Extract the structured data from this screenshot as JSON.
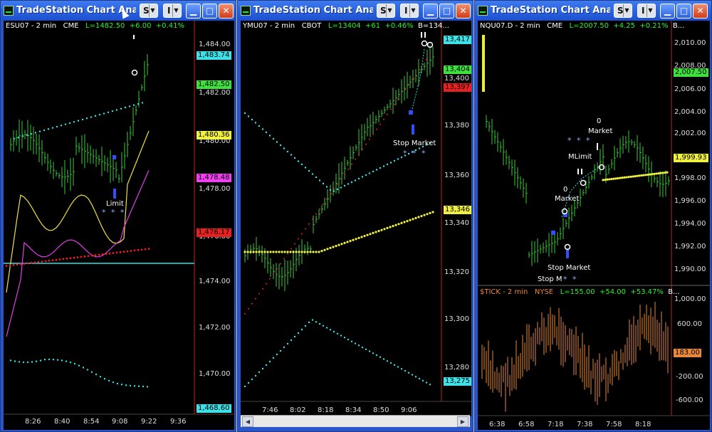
{
  "windows": [
    {
      "title": "TradeStation Chart Anal...",
      "info": {
        "symbol": "ESU07 - 2 min",
        "exchange": "CME",
        "last": "L=1482.50",
        "change": "+6.00",
        "pct": "+0.41%",
        "extra": ""
      },
      "price_labels": [
        "1,484.00",
        "1,482.00",
        "1,480.00",
        "1,478.00",
        "1,476.00",
        "1,474.00",
        "1,472.00",
        "1,470.00"
      ],
      "price_boxes": [
        {
          "text": "1,483.74",
          "color": "#40e0e8"
        },
        {
          "text": "1,482.50",
          "color": "#3ee03e"
        },
        {
          "text": "1,480.36",
          "color": "#f0f040"
        },
        {
          "text": "1,478.48",
          "color": "#f040f0"
        },
        {
          "text": "1,476.17",
          "color": "#e82020"
        },
        {
          "text": "1,468.60",
          "color": "#40e0e8"
        }
      ],
      "time_labels": [
        "8:26",
        "8:40",
        "8:54",
        "9:08",
        "9:22",
        "9:36"
      ],
      "annotations": [
        {
          "text": "Limit"
        }
      ],
      "stars": [
        "* * *"
      ],
      "button_s": "S",
      "button_i": "I"
    },
    {
      "title": "TradeStation Chart Anal...",
      "info": {
        "symbol": "YMU07 - 2 min",
        "exchange": "CBOT",
        "last": "L=13404",
        "change": "+61",
        "pct": "+0.46%",
        "extra": "B=134..."
      },
      "price_labels": [
        "13,400",
        "13,380",
        "13,360",
        "13,340",
        "13,320",
        "13,300",
        "13,280"
      ],
      "price_boxes": [
        {
          "text": "13,417",
          "color": "#40e0e8"
        },
        {
          "text": "13,404",
          "color": "#3ee03e"
        },
        {
          "text": "13,397",
          "color": "#e82020"
        },
        {
          "text": "13,346",
          "color": "#f0f040"
        },
        {
          "text": "13,275",
          "color": "#40e0e8"
        }
      ],
      "time_labels": [
        "7:46",
        "8:02",
        "8:18",
        "8:34",
        "8:50",
        "9:06"
      ],
      "annotations": [
        {
          "text": "Stop Market"
        }
      ],
      "stars": [
        "* * *"
      ],
      "button_s": "S",
      "button_i": "I"
    },
    {
      "title": "TradeStation Chart Anal...",
      "info": {
        "symbol": "NQU07.D - 2 min",
        "exchange": "CME",
        "last": "L=2007.50",
        "change": "+4.25",
        "pct": "+0.21%",
        "extra": "B..."
      },
      "info2": {
        "symbol": "$TICK - 2 min",
        "exchange": "NYSE",
        "last": "L=155.00",
        "change": "+54.00",
        "pct": "+53.47%",
        "extra": "B..."
      },
      "price_labels": [
        "2,010.00",
        "2,008.00",
        "2,006.00",
        "2,004.00",
        "2,002.00",
        "1,998.00",
        "1,996.00",
        "1,994.00",
        "1,992.00",
        "1,990.00"
      ],
      "price_boxes": [
        {
          "text": "2,007.50",
          "color": "#3ee03e"
        },
        {
          "text": "1,999.93",
          "color": "#f0f040"
        }
      ],
      "tick_labels": [
        "1,000.00",
        "600.00",
        "-200.00",
        "-600.00"
      ],
      "tick_box": {
        "text": "183.00",
        "color": "#e8883a"
      },
      "time_labels": [
        "6:38",
        "6:58",
        "7:18",
        "7:38",
        "7:58",
        "8:18"
      ],
      "annotations": [
        {
          "text": "0"
        },
        {
          "text": "Market"
        },
        {
          "text": "MLimit"
        },
        {
          "text": "0"
        },
        {
          "text": "Market"
        },
        {
          "text": "Stop Market"
        },
        {
          "text": "Stop M"
        }
      ],
      "stars": [
        "* * *",
        "* *"
      ],
      "button_s": "S",
      "button_i": "I"
    }
  ]
}
